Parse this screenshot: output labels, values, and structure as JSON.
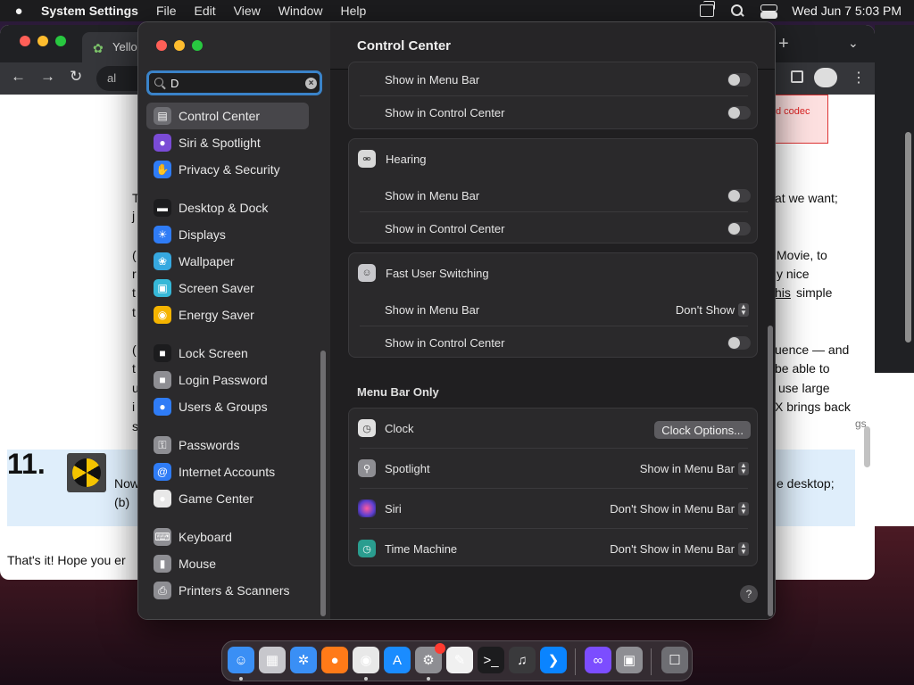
{
  "menubar": {
    "app_name": "System Settings",
    "menus": [
      "File",
      "Edit",
      "View",
      "Window",
      "Help"
    ],
    "datetime": "Wed Jun 7  5:03 PM"
  },
  "browser": {
    "tab_title": "Yello",
    "omnibox_text": "al",
    "codec_text": "d codec",
    "fragments": [
      "T",
      "j",
      "(",
      "r",
      "t",
      "t",
      "(",
      "t",
      "u",
      "i",
      "s",
      "at we want;",
      "Movie, to",
      "y nice",
      "his",
      "simple",
      "uence — and",
      "be able to",
      "use large",
      "X brings back",
      "gs",
      "Now",
      "(b)",
      "e desktop;",
      "That's it! Hope you er"
    ],
    "step_number": "11."
  },
  "settings": {
    "search": {
      "value": "D",
      "placeholder": "Search"
    },
    "sidebar": [
      {
        "label": "Control Center",
        "icon": "control-center-icon",
        "color": "#6e6e73",
        "selected": true
      },
      {
        "label": "Siri & Spotlight",
        "icon": "siri-icon",
        "color": "#7a4bd6"
      },
      {
        "label": "Privacy & Security",
        "icon": "hand-icon",
        "color": "#2f7cf6"
      },
      {
        "label": "Desktop & Dock",
        "icon": "dock-icon",
        "color": "#1c1c1e"
      },
      {
        "label": "Displays",
        "icon": "sun-icon",
        "color": "#2f7cf6"
      },
      {
        "label": "Wallpaper",
        "icon": "flower-icon",
        "color": "#36a8e0"
      },
      {
        "label": "Screen Saver",
        "icon": "screen-saver-icon",
        "color": "#36b8d8"
      },
      {
        "label": "Energy Saver",
        "icon": "bulb-icon",
        "color": "#f5b400"
      },
      {
        "label": "Lock Screen",
        "icon": "lock-icon",
        "color": "#1c1c1e"
      },
      {
        "label": "Login Password",
        "icon": "lock-icon",
        "color": "#8e8e93"
      },
      {
        "label": "Users & Groups",
        "icon": "users-icon",
        "color": "#2f7cf6"
      },
      {
        "label": "Passwords",
        "icon": "key-icon",
        "color": "#8e8e93"
      },
      {
        "label": "Internet Accounts",
        "icon": "at-icon",
        "color": "#2f7cf6"
      },
      {
        "label": "Game Center",
        "icon": "game-center-icon",
        "color": "#e8e8e8"
      },
      {
        "label": "Keyboard",
        "icon": "keyboard-icon",
        "color": "#8e8e93"
      },
      {
        "label": "Mouse",
        "icon": "mouse-icon",
        "color": "#8e8e93"
      },
      {
        "label": "Printers & Scanners",
        "icon": "printer-icon",
        "color": "#8e8e93"
      }
    ],
    "content": {
      "title": "Control Center",
      "show_in_menu_bar": "Show in Menu Bar",
      "show_in_control_center": "Show in Control Center",
      "hearing": "Hearing",
      "fast_user_switching": "Fast User Switching",
      "fus_menu_bar_value": "Don't Show",
      "menu_bar_only": "Menu Bar Only",
      "clock": "Clock",
      "clock_options": "Clock Options...",
      "spotlight": "Spotlight",
      "spotlight_value": "Show in Menu Bar",
      "siri": "Siri",
      "siri_value": "Don't Show in Menu Bar",
      "time_machine": "Time Machine",
      "time_machine_value": "Don't Show in Menu Bar",
      "help": "?"
    }
  },
  "dock": [
    {
      "name": "finder",
      "icon": "finder-icon",
      "color": "#3a8ff5",
      "running": true
    },
    {
      "name": "launchpad",
      "icon": "launchpad-icon",
      "color": "#c7c7cc",
      "running": false
    },
    {
      "name": "safari",
      "icon": "safari-icon",
      "color": "#3a8ff5",
      "running": false
    },
    {
      "name": "firefox",
      "icon": "firefox-icon",
      "color": "#ff7a18",
      "running": false
    },
    {
      "name": "chrome",
      "icon": "chrome-icon",
      "color": "#e8e8e8",
      "running": true
    },
    {
      "name": "app-store",
      "icon": "app-store-icon",
      "color": "#1a8cff",
      "running": false
    },
    {
      "name": "system-settings",
      "icon": "gear-icon",
      "color": "#8e8e93",
      "running": true
    },
    {
      "name": "textedit",
      "icon": "textedit-icon",
      "color": "#f0f0f0",
      "running": false
    },
    {
      "name": "terminal",
      "icon": "terminal-icon",
      "color": "#1c1c1e",
      "running": false
    },
    {
      "name": "garageband",
      "icon": "guitar-icon",
      "color": "#3a3a3c",
      "running": false
    },
    {
      "name": "vscode",
      "icon": "vscode-icon",
      "color": "#0a84ff",
      "running": false
    },
    {
      "name": "visual-studio",
      "icon": "visual-studio-icon",
      "color": "#7c4dff",
      "running": false
    },
    {
      "name": "preview",
      "icon": "preview-icon",
      "color": "#8e8e93",
      "running": false
    },
    {
      "name": "trash",
      "icon": "trash-icon",
      "color": "#6e6e73",
      "running": false
    }
  ]
}
